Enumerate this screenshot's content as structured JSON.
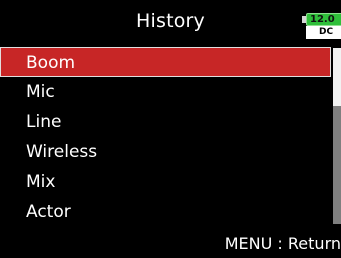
{
  "header": {
    "title": "History",
    "battery": {
      "voltage": "12.0",
      "source": "DC",
      "color": "#2fbf3a"
    }
  },
  "list": {
    "selected_index": 0,
    "highlight_color": "#c72626",
    "items": [
      {
        "label": "Boom"
      },
      {
        "label": "Mic"
      },
      {
        "label": "Line"
      },
      {
        "label": "Wireless"
      },
      {
        "label": "Mix"
      },
      {
        "label": "Actor"
      }
    ]
  },
  "scroll": {
    "thumb_fraction": 0.33,
    "position_fraction": 0.0
  },
  "footer": {
    "hint": "MENU : Return"
  }
}
